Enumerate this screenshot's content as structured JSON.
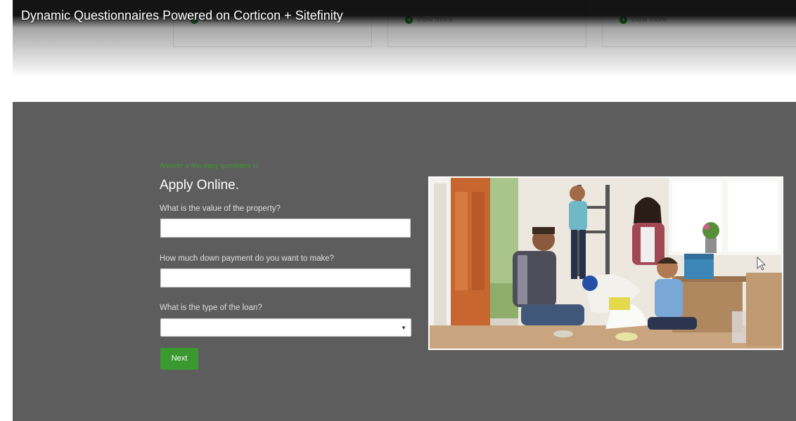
{
  "video": {
    "title": "Dynamic Questionnaires Powered on Corticon + Sitefinity"
  },
  "cards": [
    {
      "label": "View more"
    },
    {
      "label": "View more"
    },
    {
      "label": "View more"
    }
  ],
  "form": {
    "tagline": "Answer a few easy questions to",
    "title": "Apply Online.",
    "questions": [
      {
        "label": "What is the value of the property?",
        "value": ""
      },
      {
        "label": "How much down payment do you want to make?",
        "value": ""
      },
      {
        "label": "What is the type of the loan?",
        "value": ""
      }
    ],
    "next_label": "Next"
  },
  "colors": {
    "accent_green": "#3a9a30",
    "section_gray": "#5d5d5d"
  },
  "icons": [
    "plus-circle-icon",
    "caret-down-icon",
    "mouse-cursor-icon"
  ]
}
